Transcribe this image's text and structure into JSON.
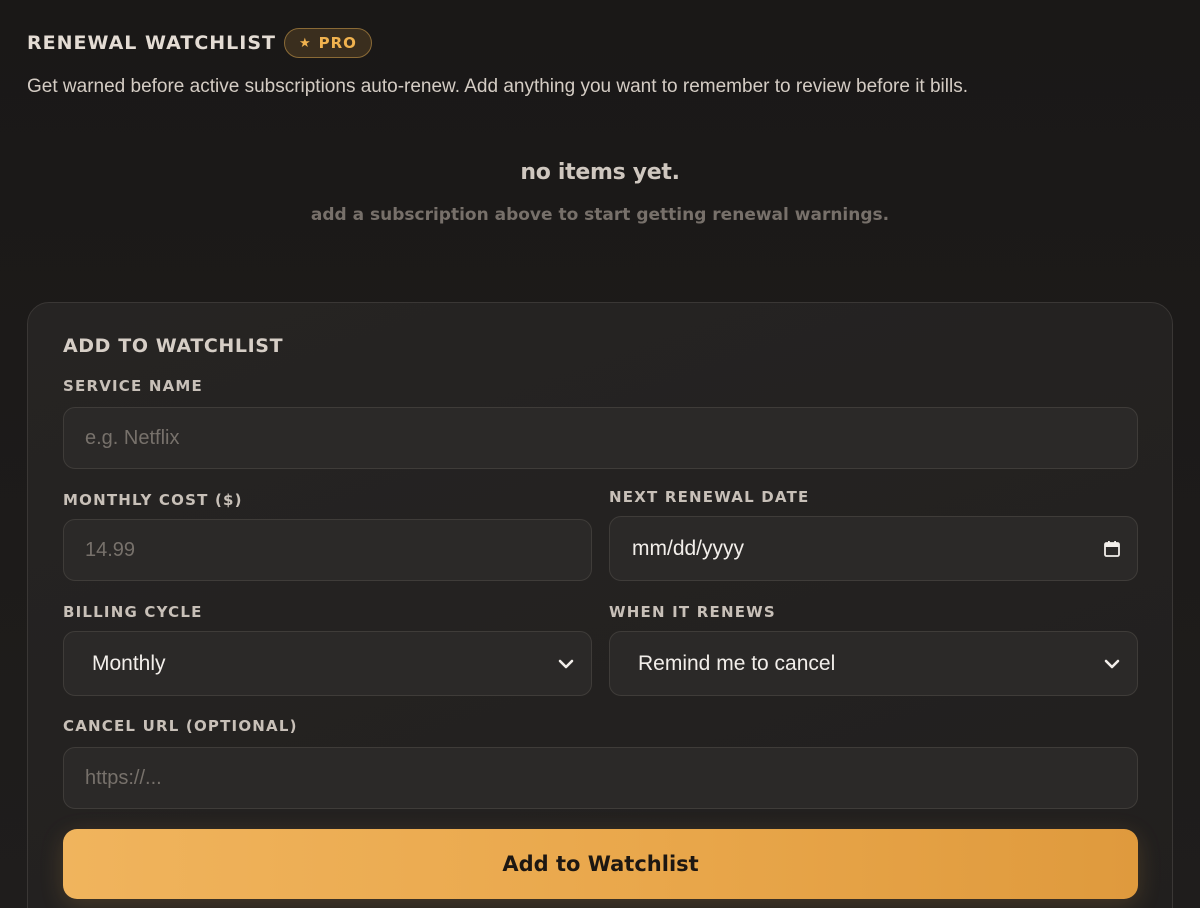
{
  "header": {
    "title": "RENEWAL WATCHLIST",
    "badge_label": "PRO",
    "subtitle": "Get warned before active subscriptions auto-renew. Add anything you want to remember to review before it bills."
  },
  "empty_state": {
    "title": "no items yet.",
    "hint": "add a subscription above to start getting renewal warnings."
  },
  "form": {
    "title": "ADD TO WATCHLIST",
    "service_name": {
      "label": "SERVICE NAME",
      "placeholder": "e.g. Netflix",
      "value": ""
    },
    "monthly_cost": {
      "label": "MONTHLY COST ($)",
      "placeholder": "14.99",
      "value": ""
    },
    "next_renewal": {
      "label": "NEXT RENEWAL DATE",
      "value": "mm/dd/yyyy"
    },
    "billing_cycle": {
      "label": "BILLING CYCLE",
      "selected": "Monthly"
    },
    "when_renews": {
      "label": "WHEN IT RENEWS",
      "selected": "Remind me to cancel"
    },
    "cancel_url": {
      "label": "CANCEL URL (OPTIONAL)",
      "placeholder": "https://...",
      "value": ""
    },
    "submit_label": "Add to Watchlist"
  },
  "colors": {
    "accent": "#f0b24f",
    "background": "#1c1a19",
    "card": "#232120",
    "input": "#2b2928"
  },
  "icons": {
    "badge": "star-icon",
    "select": "chevron-down-icon",
    "date": "calendar-icon"
  }
}
